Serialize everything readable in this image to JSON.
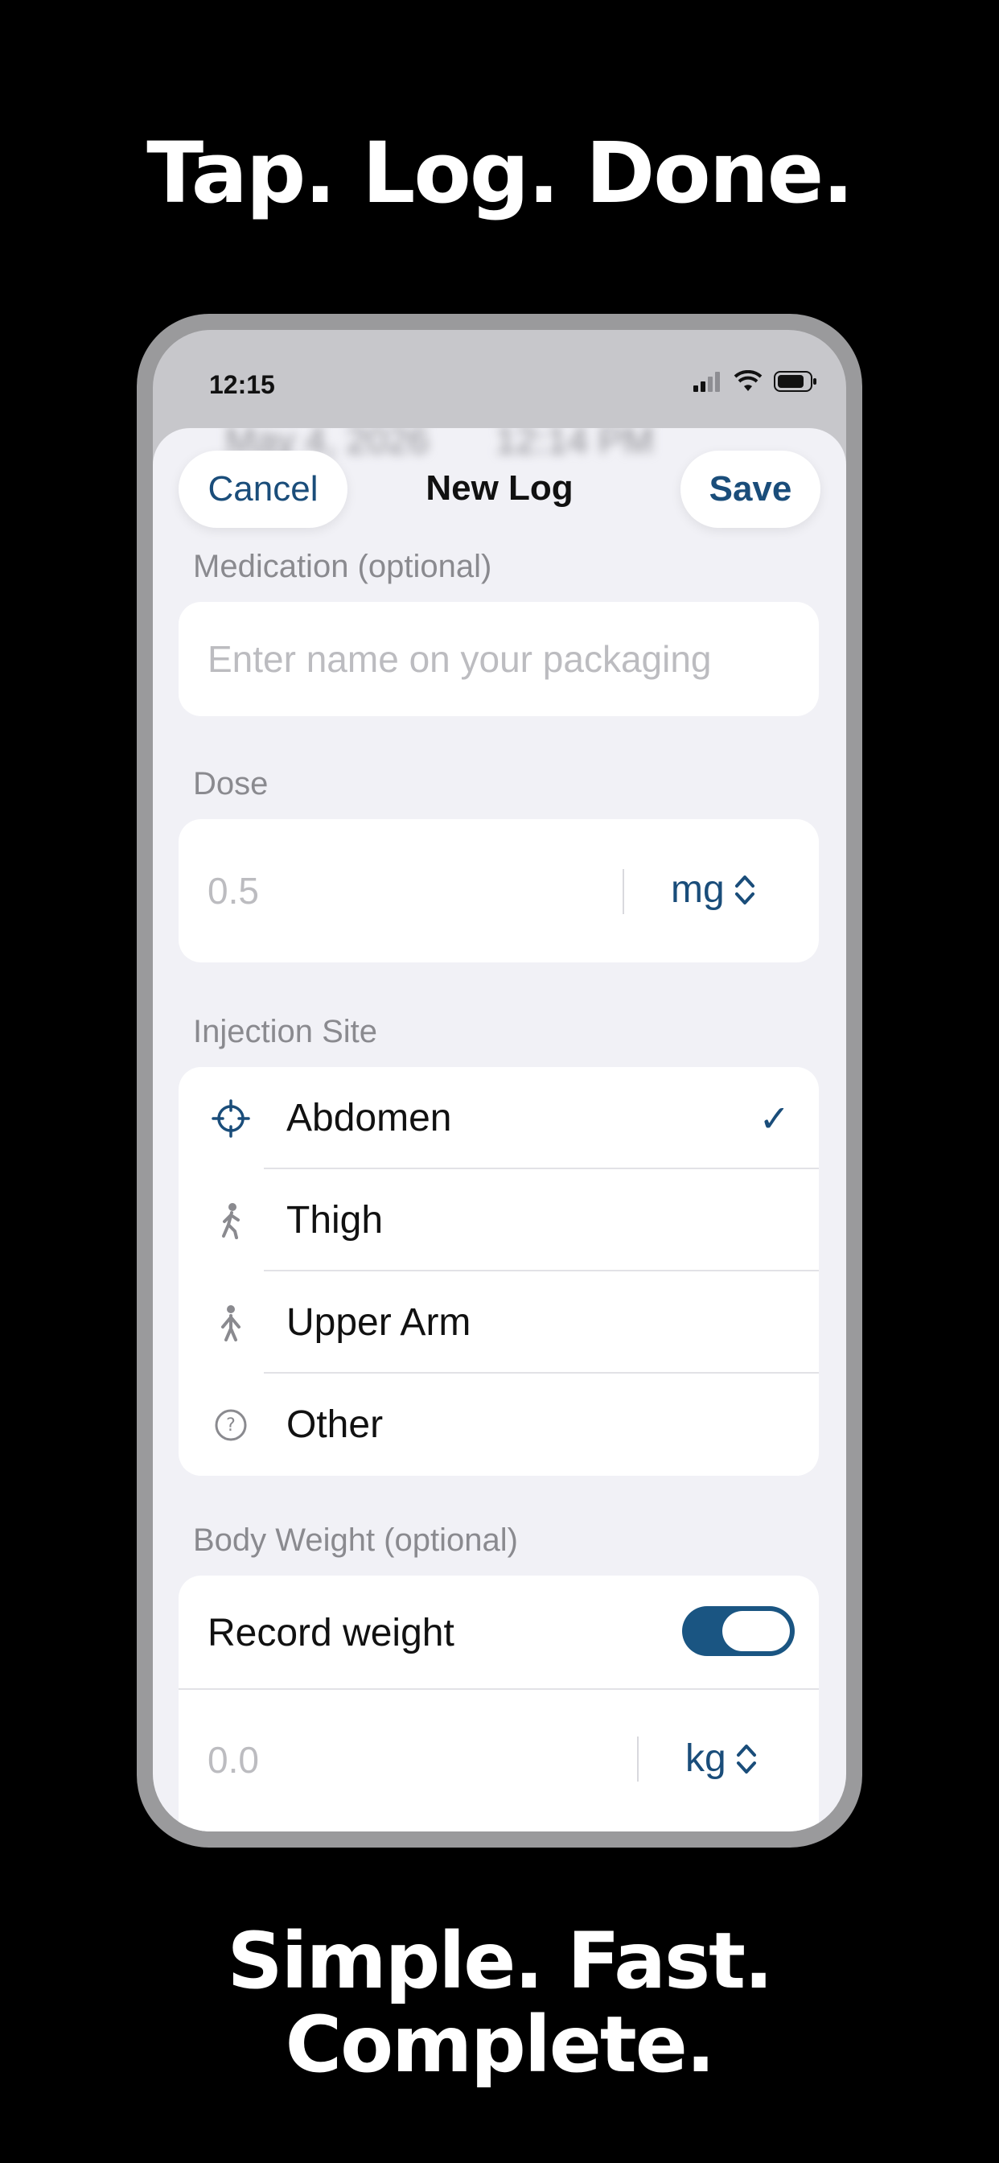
{
  "headline_top": "Tap. Log. Done.",
  "headline_bottom_line1": "Simple. Fast.",
  "headline_bottom_line2": "Complete.",
  "status_bar": {
    "time": "12:15"
  },
  "background_header": {
    "date": "May 4, 2026",
    "time": "12:14 PM"
  },
  "navbar": {
    "cancel_label": "Cancel",
    "title": "New Log",
    "save_label": "Save"
  },
  "medication": {
    "label": "Medication (optional)",
    "placeholder": "Enter name on your packaging"
  },
  "dose": {
    "label": "Dose",
    "placeholder": "0.5",
    "unit": "mg"
  },
  "injection_site": {
    "label": "Injection Site",
    "options": [
      {
        "label": "Abdomen",
        "icon": "crosshair-icon",
        "selected": true
      },
      {
        "label": "Thigh",
        "icon": "walking-person-icon",
        "selected": false
      },
      {
        "label": "Upper Arm",
        "icon": "standing-person-icon",
        "selected": false
      },
      {
        "label": "Other",
        "icon": "question-circle-icon",
        "selected": false
      }
    ]
  },
  "body_weight": {
    "label": "Body Weight (optional)",
    "record_label": "Record weight",
    "record_enabled": true,
    "placeholder": "0.0",
    "unit": "kg"
  },
  "colors": {
    "accent": "#1a4d7a",
    "toggle_on": "#1a5582",
    "background": "#000000"
  }
}
